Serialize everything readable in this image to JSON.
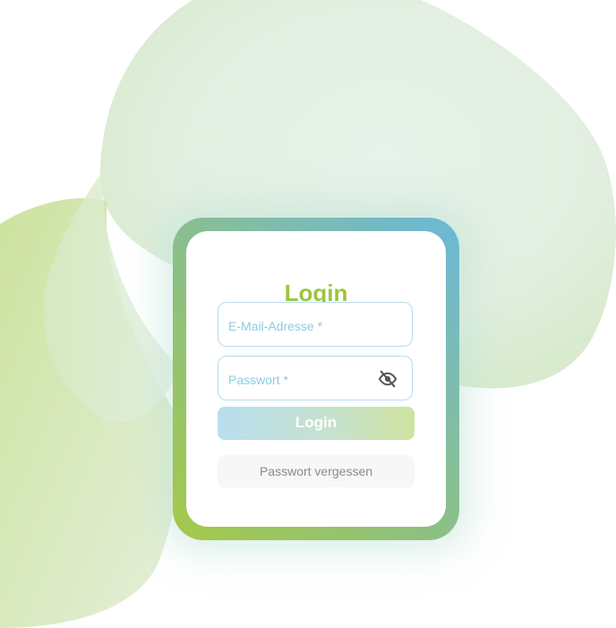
{
  "login_card": {
    "title": "Login",
    "email_field": {
      "placeholder": "E-Mail-Adresse *",
      "value": ""
    },
    "password_field": {
      "placeholder": "Passwort *",
      "value": "",
      "visibility_icon": "eye-off-icon"
    },
    "login_button_label": "Login",
    "forgot_password_label": "Passwort vergessen"
  },
  "colors": {
    "title_green": "#9cc43f",
    "frame_gradient_start": "#a4c94a",
    "frame_gradient_end": "#6ab8d8",
    "field_border": "#b9dcec",
    "placeholder_blue": "#8ccbe3",
    "background_blob_green": "#cfe3a6",
    "background_blob_mint": "#e3f0e4"
  }
}
